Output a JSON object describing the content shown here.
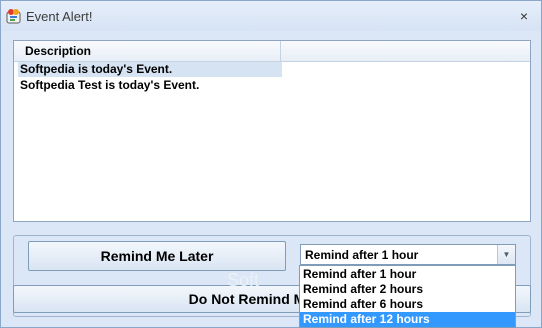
{
  "window": {
    "title": "Event Alert!",
    "close_glyph": "×"
  },
  "list": {
    "header": "Description",
    "rows": [
      {
        "text": "Softpedia  is today's Event.",
        "selected": true
      },
      {
        "text": "Softpedia Test is today's Event.",
        "selected": false
      }
    ]
  },
  "buttons": {
    "remind_later": "Remind Me Later",
    "do_not_remind": "Do Not Remind Me Again"
  },
  "remind_select": {
    "selected": "Remind after 1 hour",
    "options": [
      "Remind after 1 hour",
      "Remind after 2 hours",
      "Remind after 6 hours",
      "Remind after 12 hours"
    ],
    "highlighted_index": 3
  },
  "watermark": "Soft",
  "colors": {
    "highlight": "#3399ff",
    "row_selected": "#d6e3f3"
  },
  "icons": {
    "app": "app-icon",
    "close": "close-icon",
    "dropdown": "chevron-down-icon"
  }
}
